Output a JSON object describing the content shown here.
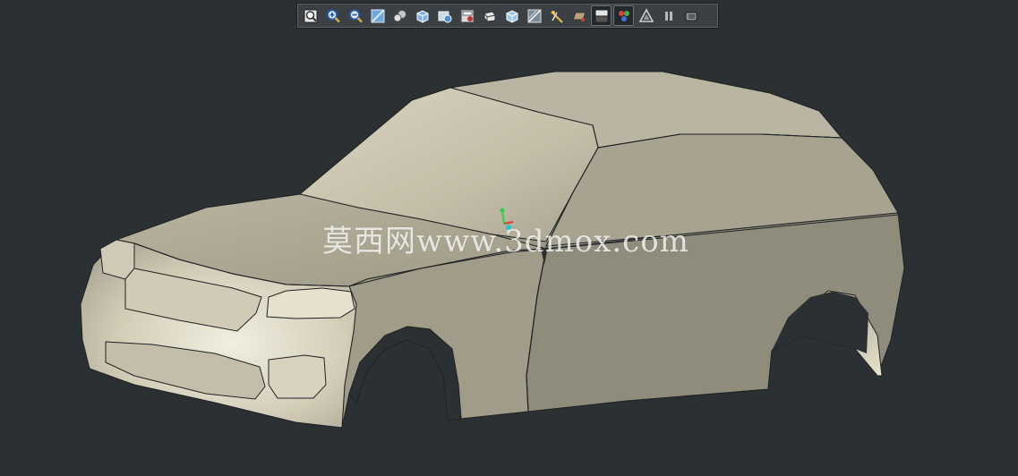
{
  "app": {
    "background_color": "#2b3133",
    "model_surface_color": "#b7b3a1",
    "edge_color": "#1f2224"
  },
  "toolbar": {
    "buttons": [
      {
        "name": "zoom-fit-button",
        "icon": "zoom-fit-icon"
      },
      {
        "name": "zoom-in-button",
        "icon": "zoom-in-icon"
      },
      {
        "name": "zoom-out-button",
        "icon": "zoom-out-icon"
      },
      {
        "name": "zoom-area-button",
        "icon": "zoom-area-icon"
      },
      {
        "name": "view-orientation-button",
        "icon": "view-orientation-icon"
      },
      {
        "name": "display-style-button",
        "icon": "display-style-icon"
      },
      {
        "name": "hide-show-button",
        "icon": "hide-show-icon"
      },
      {
        "name": "edit-appearance-button",
        "icon": "edit-appearance-icon"
      },
      {
        "name": "apply-scene-button",
        "icon": "apply-scene-icon"
      },
      {
        "name": "view-settings-button",
        "icon": "view-settings-icon"
      },
      {
        "name": "section-view-button",
        "icon": "section-view-icon"
      },
      {
        "name": "dynamic-annotation-button",
        "icon": "dynamic-annotation-icon"
      },
      {
        "name": "plane-button",
        "icon": "plane-icon"
      },
      {
        "name": "shadows-button",
        "icon": "shadows-icon"
      },
      {
        "name": "realview-button",
        "icon": "realview-icon"
      },
      {
        "name": "perspective-button",
        "icon": "perspective-icon"
      },
      {
        "name": "pause-button",
        "icon": "pause-icon"
      },
      {
        "name": "more-button",
        "icon": "more-icon"
      }
    ]
  },
  "watermark": {
    "text": "莫西网www.3dmox.com"
  }
}
